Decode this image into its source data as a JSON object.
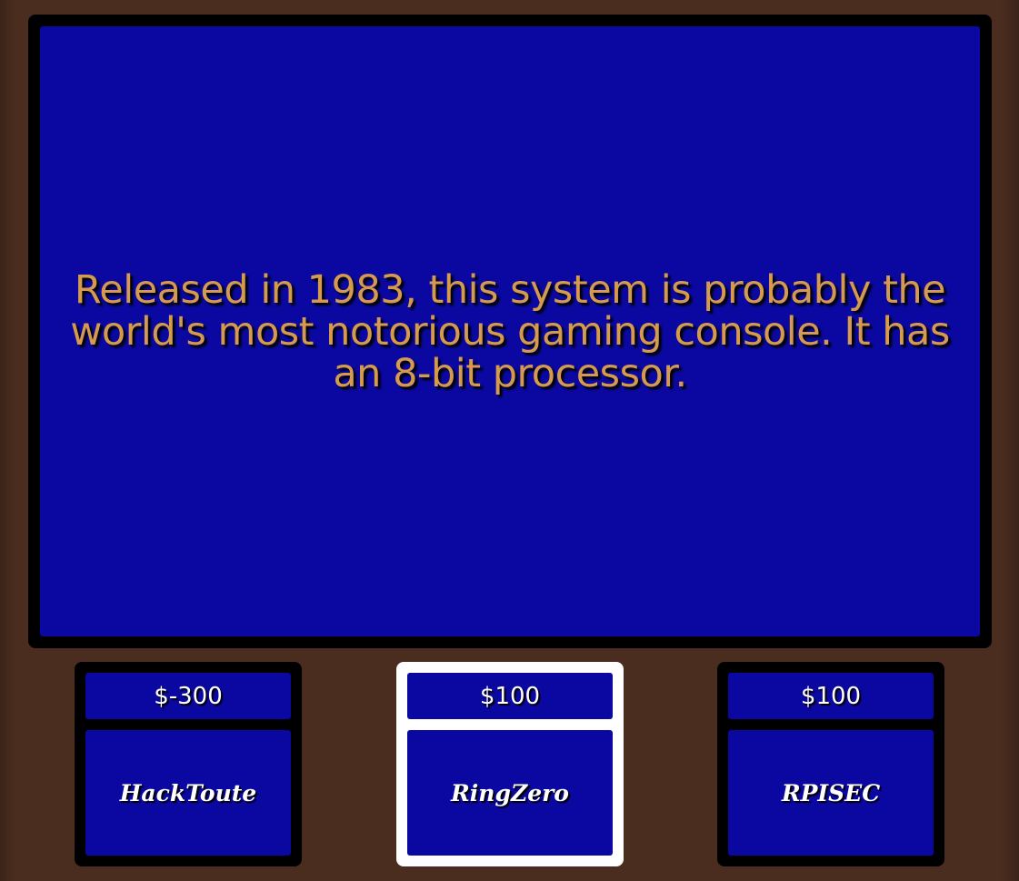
{
  "clue": {
    "text": "Released in 1983, this system is probably the world's most notorious gaming console. It has an 8-bit processor."
  },
  "players": [
    {
      "name": "HackToute",
      "score": "$-300",
      "active": false
    },
    {
      "name": "RingZero",
      "score": "$100",
      "active": true
    },
    {
      "name": "RPISEC",
      "score": "$100",
      "active": false
    }
  ],
  "colors": {
    "board_blue": "#0a08a0",
    "clue_text": "#d69a4f",
    "background_wood": "#4b2d1f",
    "active_highlight": "#ffffff"
  }
}
